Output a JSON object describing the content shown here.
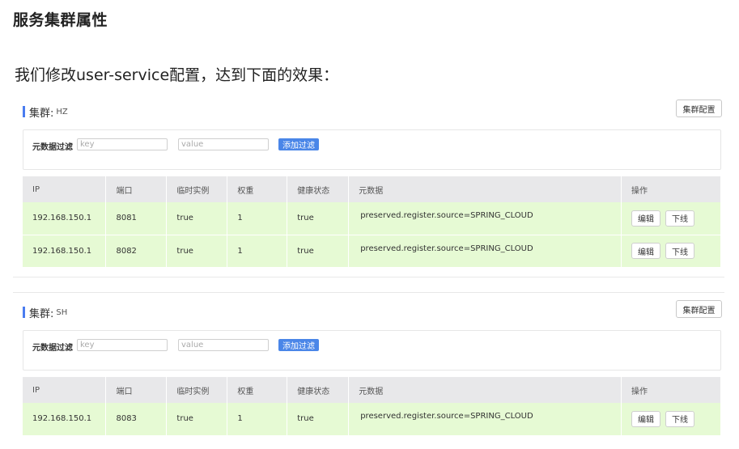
{
  "page_title": "服务集群属性",
  "intro": "我们修改user-service配置，达到下面的效果：",
  "cluster_label": "集群:",
  "cluster_config_label": "集群配置",
  "filter_label": "元数据过滤",
  "filter_key_placeholder": "key",
  "filter_value_placeholder": "value",
  "add_filter_label": "添加过滤",
  "columns": [
    "IP",
    "端口",
    "临时实例",
    "权重",
    "健康状态",
    "元数据",
    "操作"
  ],
  "edit_label": "编辑",
  "offline_label": "下线",
  "row_bg_color": "#e6fad4",
  "accent_color": "#4a7cf0",
  "clusters": [
    {
      "name": "HZ",
      "instances": [
        {
          "ip": "192.168.150.1",
          "port": "8081",
          "ephemeral": "true",
          "weight": "1",
          "healthy": "true",
          "metadata": "preserved.register.source=SPRING_CLOUD"
        },
        {
          "ip": "192.168.150.1",
          "port": "8082",
          "ephemeral": "true",
          "weight": "1",
          "healthy": "true",
          "metadata": "preserved.register.source=SPRING_CLOUD"
        }
      ]
    },
    {
      "name": "SH",
      "instances": [
        {
          "ip": "192.168.150.1",
          "port": "8083",
          "ephemeral": "true",
          "weight": "1",
          "healthy": "true",
          "metadata": "preserved.register.source=SPRING_CLOUD"
        }
      ]
    }
  ]
}
